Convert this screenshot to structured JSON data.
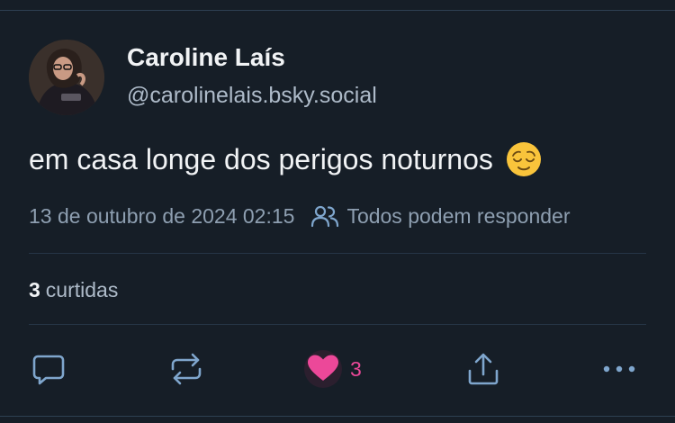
{
  "author": {
    "display_name": "Caroline Laís",
    "handle": "@carolinelais.bsky.social",
    "avatar_icon": "profile-photo"
  },
  "post": {
    "text": "em casa longe dos perigos noturnos",
    "emoji": "relieved-face-emoji",
    "timestamp": "13 de outubro de 2024 02:15",
    "reply_setting": "Todos podem responder"
  },
  "stats": {
    "likes_count": "3",
    "likes_label": "curtidas"
  },
  "actions": {
    "reply_icon": "reply-icon",
    "repost_icon": "repost-icon",
    "like_icon": "heart-icon",
    "like_count": "3",
    "share_icon": "share-icon",
    "more_icon": "more-options-icon"
  },
  "colors": {
    "background": "#161e27",
    "text_primary": "#f1f3f5",
    "text_secondary": "#aebbc9",
    "icon": "#7fa6cd",
    "like_accent": "#ec4899"
  }
}
